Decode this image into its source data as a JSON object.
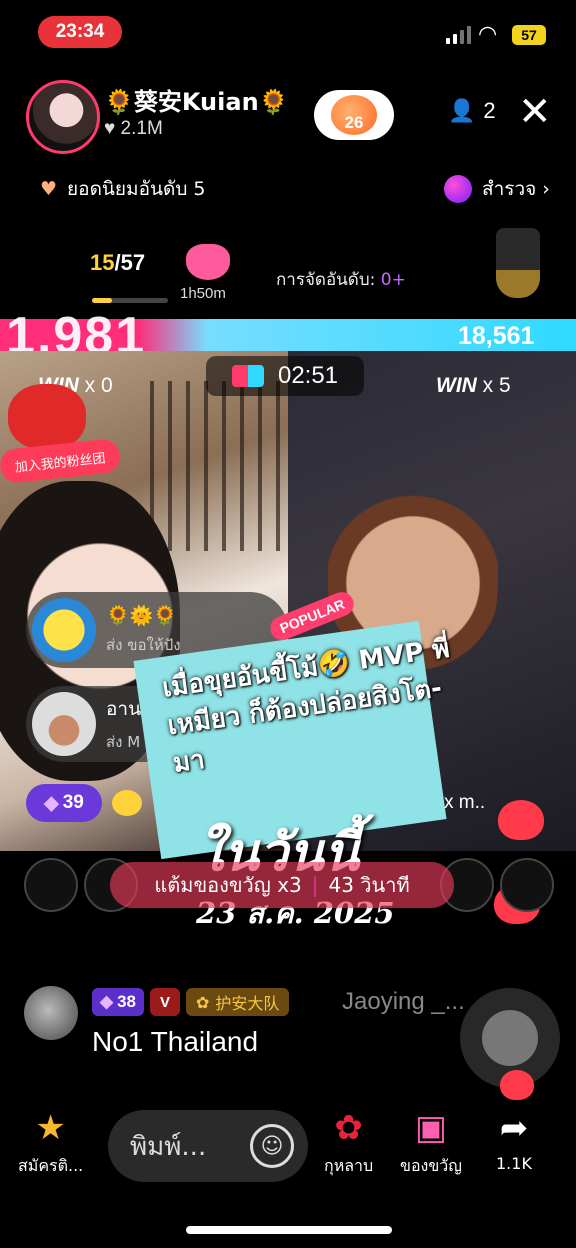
{
  "status": {
    "time": "23:34",
    "battery": "57"
  },
  "host": {
    "name": "🌻葵安Kuian🌻",
    "likes": "♥ 2.1M",
    "follow_level": "26",
    "viewers": "2"
  },
  "ranking": {
    "label": "ยอดนิยมอันดับ 5",
    "explore_label": "สำรวจ ›"
  },
  "progress": {
    "current": "15",
    "total": "/57",
    "timer": "1h50m",
    "fill": 0.26
  },
  "arrange": {
    "label": "การจัดอันดับ:",
    "value": "0+"
  },
  "battle": {
    "left_score": "1,981",
    "right_score": "18,561",
    "timer": "02:51",
    "left_win": "x 0",
    "right_win": "x 5",
    "win_word": "WIN"
  },
  "fan_club": {
    "label": "加入我的粉丝团"
  },
  "chat_cards": [
    {
      "line1": "🌻🌞🌻",
      "line2": "ส่ง ขอให้ปัง"
    },
    {
      "line1": "อาน",
      "line2": "ส่ง M"
    }
  ],
  "gem_badge": "39",
  "overlay": {
    "popular": "POPULAR",
    "caption": "เมื่อขุยอันขี้โม้🤣 MVP พี่เหมียว ก็ต้องปล่อยสิงโต-มา",
    "big": "ในวันนี้",
    "date": "23 ส.ค. 2025",
    "more_names": "x m.."
  },
  "gift_bar": {
    "left": "แต้มของขวัญ x3",
    "right": "43 วินาที"
  },
  "chat": {
    "gem_level": "38",
    "v_badge": "V",
    "fan_badge": "护安大队",
    "user": "Jaoying _...",
    "message": "No1 Thailand"
  },
  "toolbar": {
    "subscribe": "สมัครติ...",
    "comment_placeholder": "พิมพ์...",
    "rose": "กุหลาบ",
    "gift": "ของขวัญ",
    "share": "1.1K"
  },
  "icons": [
    "signal-icon",
    "wifi-icon",
    "battery-icon",
    "heart-icon",
    "person-icon",
    "close-icon",
    "orb-icon",
    "trophy-icon",
    "smile-icon",
    "rose-icon",
    "gift-icon",
    "share-icon",
    "star-icon"
  ],
  "colors": {
    "accent_pink": "#ff2d7a",
    "accent_cyan": "#2fd9ff",
    "gold": "#ffd23a",
    "status_red": "#e8333a"
  }
}
